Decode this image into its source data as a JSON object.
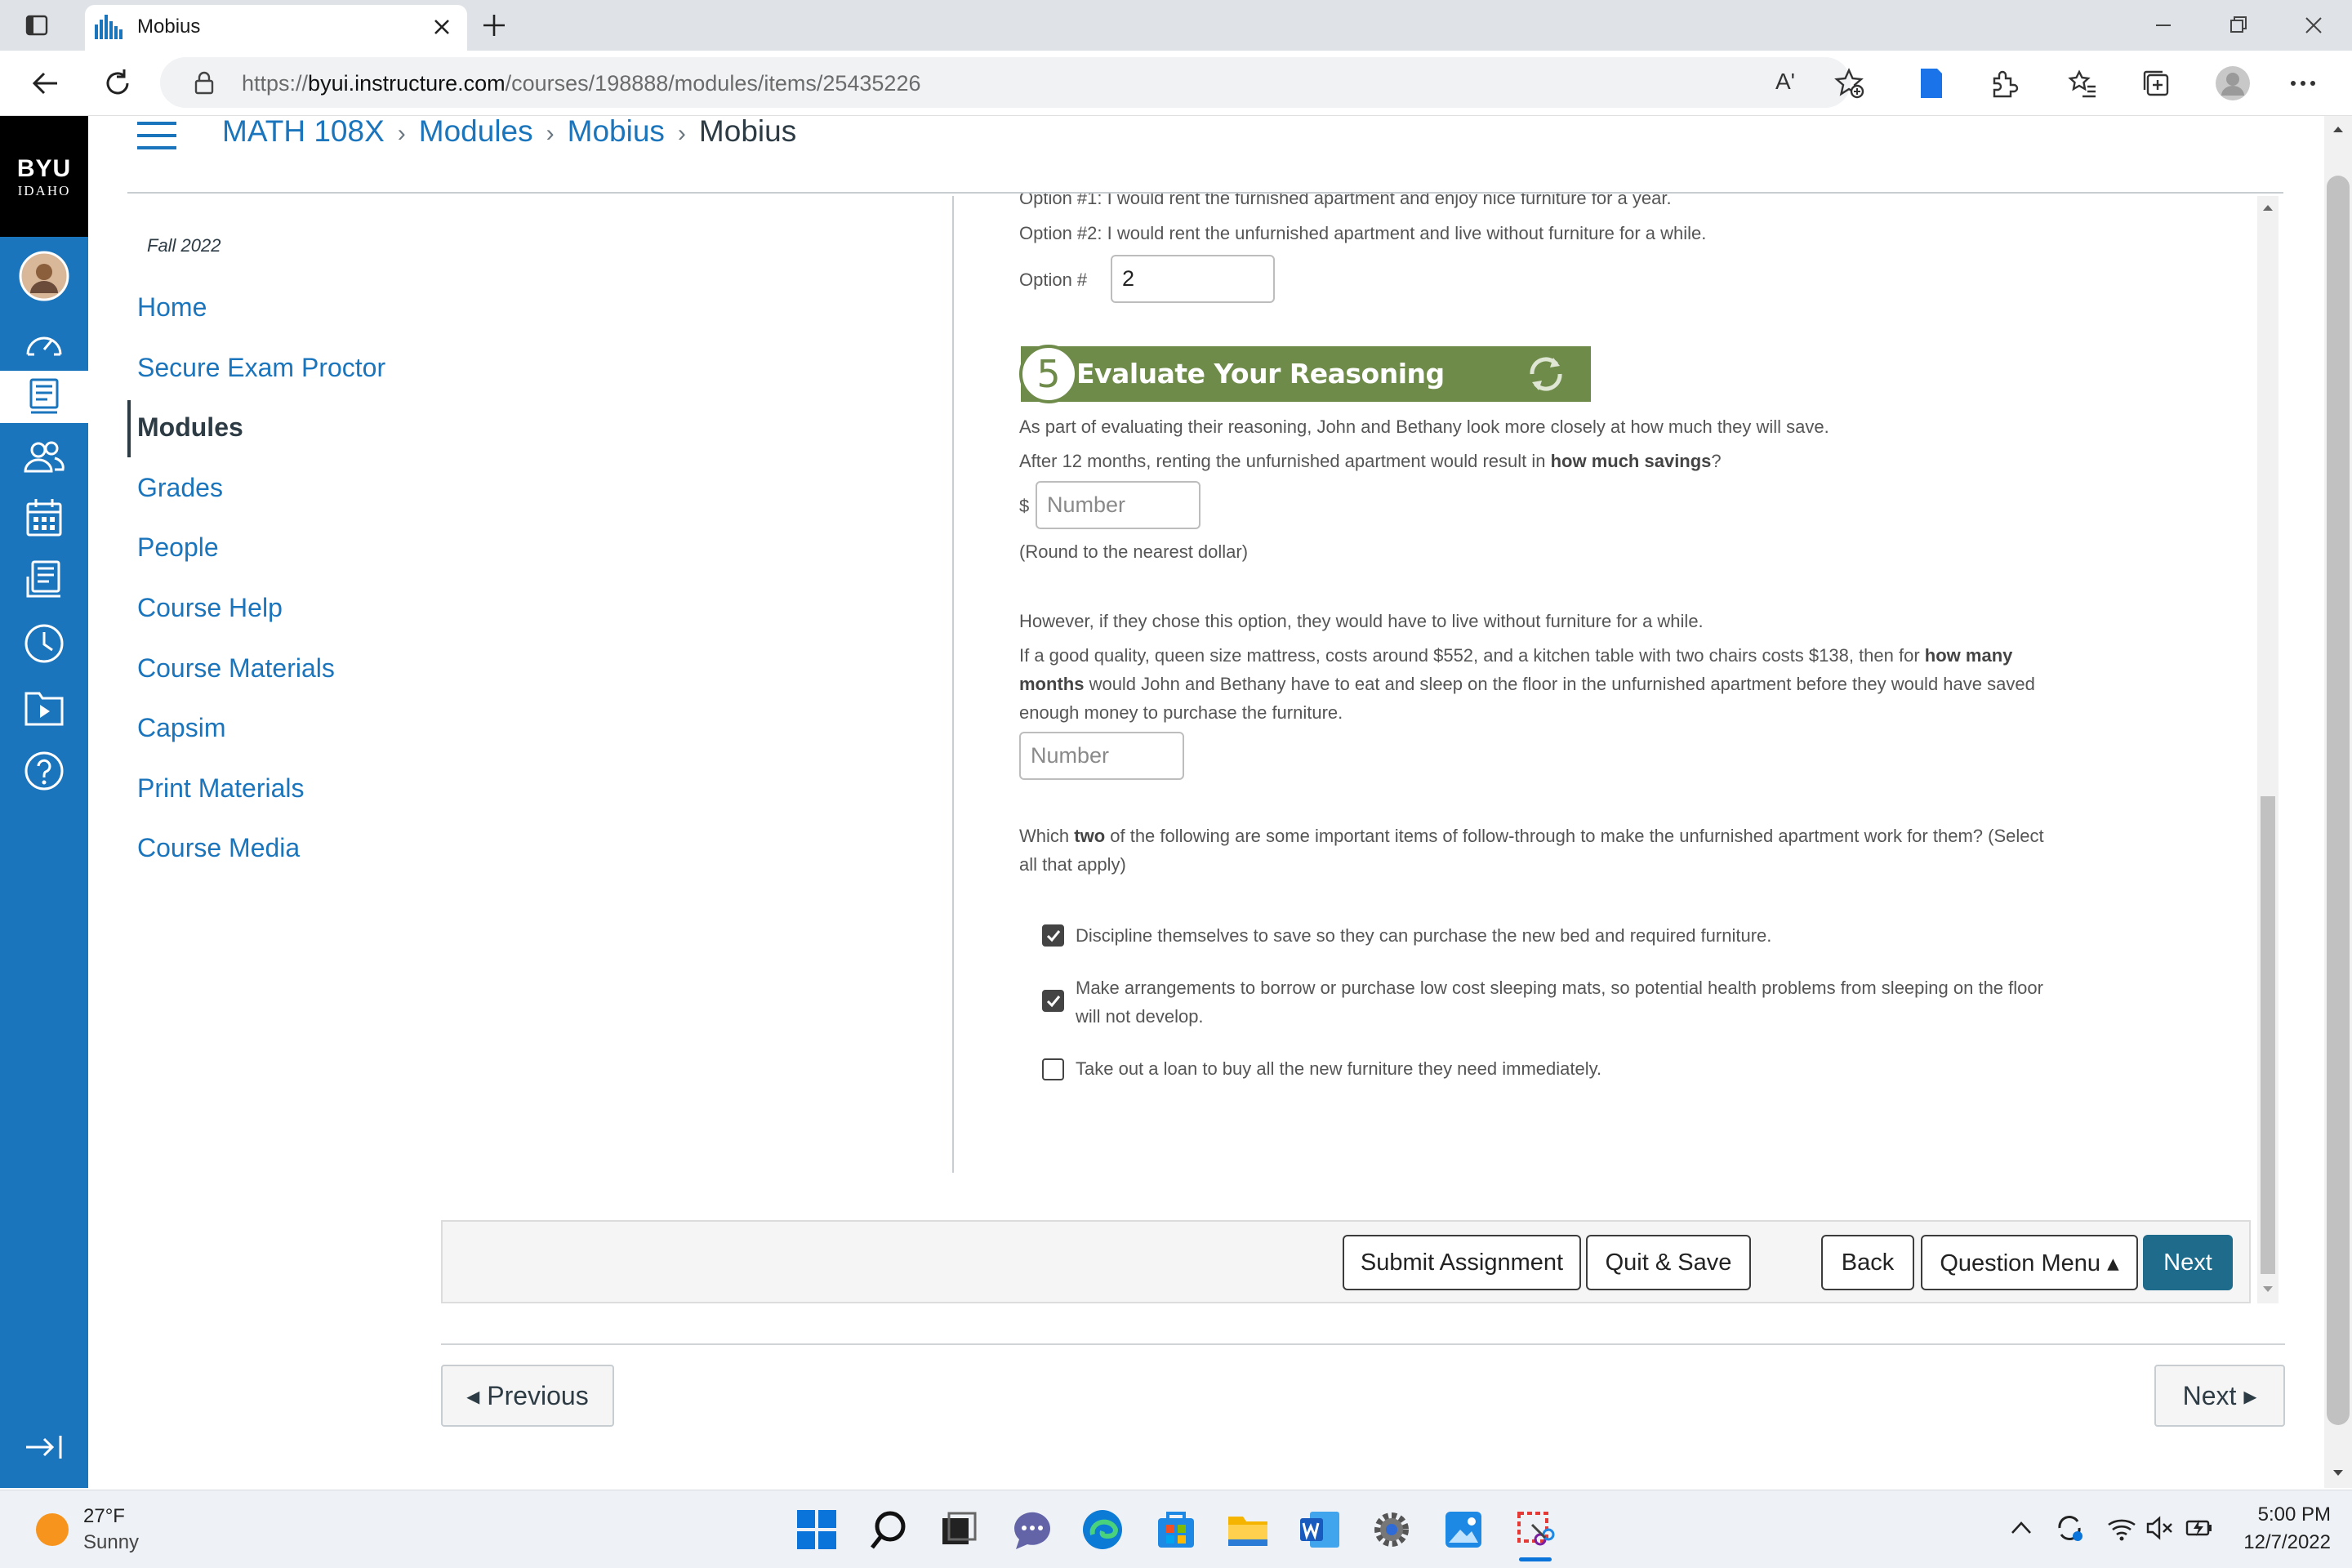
{
  "browser": {
    "tab_title": "Mobius",
    "url_prefix": "https://",
    "url_domain": "byui.instructure.com",
    "url_path": "/courses/198888/modules/items/25435226",
    "read_aloud_icon": "Aʹ"
  },
  "canvas_nav": {
    "logo_line1": "BYU",
    "logo_line2": "IDAHO",
    "icons": [
      "avatar",
      "dashboard-icon",
      "courses-icon",
      "groups-icon",
      "calendar-icon",
      "inbox-icon",
      "history-icon",
      "studio-icon",
      "help-icon"
    ],
    "collapse_icon": "collapse-icon"
  },
  "breadcrumb": {
    "items": [
      "MATH 108X",
      "Modules",
      "Mobius",
      "Mobius"
    ]
  },
  "course_nav": {
    "term": "Fall 2022",
    "items": [
      "Home",
      "Secure Exam Proctor",
      "Modules",
      "Grades",
      "People",
      "Course Help",
      "Course Materials",
      "Capsim",
      "Print Materials",
      "Course Media"
    ],
    "active": "Modules"
  },
  "question": {
    "option1_text": "Option #1: I would rent the furnished apartment and enjoy nice furniture for a year.",
    "option2_text": "Option #2: I would rent the unfurnished apartment and live without furniture for a while.",
    "option_label": "Option #",
    "option_value": "2",
    "section_number": "5",
    "section_title": "Evaluate Your Reasoning",
    "intro": "As part of evaluating their reasoning, John and Bethany look more closely at how much they will save.",
    "savings_q_start": "After 12 months, renting the unfurnished apartment would result in ",
    "savings_q_bold": "how much savings",
    "savings_q_end": "?",
    "currency": "$",
    "number_placeholder": "Number",
    "round_note": "(Round to the nearest dollar)",
    "however": "However, if they chose this option, they would have to live without furniture for a while.",
    "months_q_line1_start": "If a good quality, queen size mattress, costs around $552, and a kitchen table with two chairs costs $138, then for ",
    "months_q_line1_bold": "how many",
    "months_q_line2_bold": "months",
    "months_q_line2_end": " would John and Bethany have to eat and sleep on the floor in the unfurnished apartment before they would have saved",
    "months_q_line3": "enough money to purchase the furniture.",
    "which_start": "Which ",
    "which_bold": "two",
    "which_end": " of the following are some important items of follow-through to make the unfurnished apartment work for them? (Select",
    "which_line2": "all that apply)",
    "choices": [
      {
        "text": "Discipline themselves to save so they can purchase the new bed and required furniture.",
        "text2": "",
        "checked": true
      },
      {
        "text": "Make arrangements to borrow or purchase low cost sleeping mats, so potential health problems from sleeping on the floor",
        "text2": "will not develop.",
        "checked": true
      },
      {
        "text": "Take out a loan to buy all the new furniture they need immediately.",
        "text2": "",
        "checked": false
      }
    ]
  },
  "toolbar": {
    "submit": "Submit Assignment",
    "quit": "Quit & Save",
    "back": "Back",
    "menu": "Question Menu ▴",
    "next": "Next"
  },
  "footer_nav": {
    "previous": "◂ Previous",
    "next": "Next ▸"
  },
  "taskbar": {
    "temp": "27°F",
    "weather": "Sunny",
    "time": "5:00 PM",
    "date": "12/7/2022",
    "apps": [
      "windows-icon",
      "search-icon",
      "task-view-icon",
      "chat-icon",
      "edge-icon",
      "store-icon",
      "file-explorer-icon",
      "word-icon",
      "settings-icon",
      "photos-icon",
      "snipping-tool-icon"
    ]
  }
}
